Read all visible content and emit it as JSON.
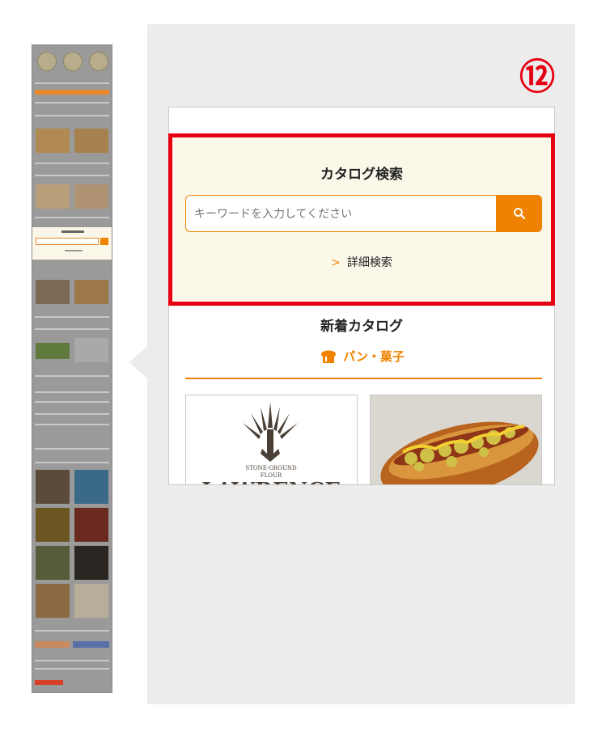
{
  "annotation_number": "⑫",
  "catalog_search": {
    "title": "カタログ検索",
    "placeholder": "キーワードを入力してください",
    "advanced_link": "詳細検索"
  },
  "new_catalog": {
    "title": "新着カタログ",
    "category": "パン・菓子",
    "items": [
      {
        "image": "lawrence-flour-logo",
        "text_lines": [
          "STONE-GROUND",
          "FLOUR",
          "LAWRENCE"
        ]
      },
      {
        "image": "hot-dog-bread-photo"
      }
    ]
  },
  "colors": {
    "accent": "#f08200",
    "highlight": "#e60012",
    "section_bg": "#fbf8e9"
  }
}
